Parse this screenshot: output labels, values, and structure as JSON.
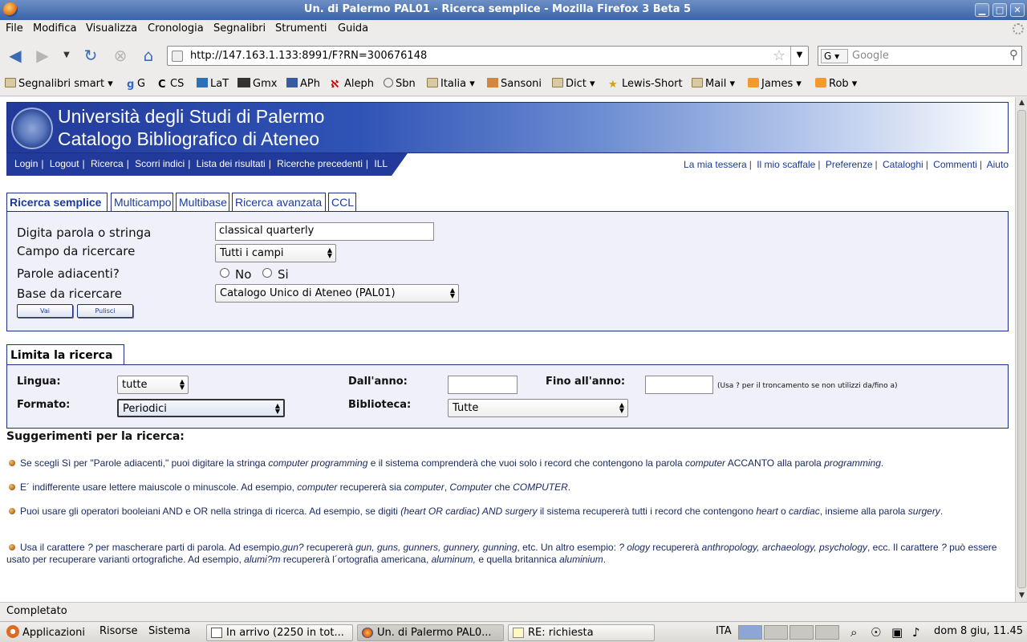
{
  "window": {
    "title": "Un. di Palermo PAL01 - Ricerca semplice - Mozilla Firefox 3 Beta 5"
  },
  "menu": [
    "File",
    "Modifica",
    "Visualizza",
    "Cronologia",
    "Segnalibri",
    "Strumenti",
    "Guida"
  ],
  "nav": {
    "url": "http://147.163.1.133:8991/F?RN=300676148",
    "search_placeholder": "Google",
    "search_engine": "G"
  },
  "bookmarks": [
    "Segnalibri smart",
    "G",
    "CS",
    "LaT",
    "Gmx",
    "APh",
    "Aleph",
    "Sbn",
    "Italia",
    "Sansoni",
    "Dict",
    "Lewis-Short",
    "Mail",
    "James",
    "Rob"
  ],
  "banner": {
    "line1": "Università degli Studi di Palermo",
    "line2": "Catalogo Bibliografico di Ateneo"
  },
  "site_nav": [
    "Login",
    "Logout",
    "Ricerca",
    "Scorri indici",
    "Lista dei risultati",
    "Ricerche precedenti",
    "ILL"
  ],
  "top_links": [
    "La mia tessera",
    "Il mio scaffale",
    "Preferenze",
    "Cataloghi",
    "Commenti",
    "Aiuto"
  ],
  "tabs": [
    "Ricerca semplice",
    "Multicampo",
    "Multibase",
    "Ricerca avanzata",
    "CCL"
  ],
  "form": {
    "query_label": "Digita parola o stringa",
    "query_value": "classical quarterly",
    "field_label": "Campo da ricercare",
    "field_value": "Tutti i campi",
    "adjacent_label": "Parole adiacenti?",
    "adjacent_no": "No",
    "adjacent_si": "Si",
    "base_label": "Base da ricercare",
    "base_value": "Catalogo Unico di Ateneo (PAL01)",
    "go_button": "Vai",
    "clear_button": "Pulisci"
  },
  "limit": {
    "title": "Limita la ricerca a:",
    "lingua_label": "Lingua:",
    "lingua_value": "tutte",
    "formato_label": "Formato:",
    "formato_value": "Periodici",
    "dall_label": "Dall'anno:",
    "fino_label": "Fino all'anno:",
    "note": "(Usa ? per il troncamento se non utilizzi da/fino a)",
    "biblioteca_label": "Biblioteca:",
    "biblioteca_value": "Tutte"
  },
  "tips": {
    "title": "Suggerimenti per la ricerca:",
    "t1": [
      "Se scegli Sì per \"Parole adiacenti,\" puoi digitare la stringa ",
      "computer programming",
      " e il sistema comprenderà che vuoi solo i record che contengono la parola ",
      "computer",
      " ACCANTO alla parola ",
      "programming",
      "."
    ],
    "t2": [
      "E´ indifferente usare lettere maiuscole o minuscole. Ad esempio, ",
      "computer",
      " recupererà sia ",
      "computer",
      ", ",
      "Computer",
      " che ",
      "COMPUTER",
      "."
    ],
    "t3": [
      "Puoi usare gli operatori booleiani AND e OR nella stringa di ricerca. Ad esempio, se digiti ",
      "(heart OR cardiac) AND surgery",
      " il sistema recupererà tutti i record che contengono ",
      "heart",
      " o ",
      "cardiac",
      ", insieme alla parola ",
      "surgery",
      "."
    ],
    "t4": [
      "Usa il carattere ",
      "?",
      " per mascherare parti di parola. Ad esempio,",
      "gun?",
      " recupererà ",
      "gun, guns, gunners, gunnery, gunning",
      ", etc. Un altro esempio: ",
      "? ology",
      " recupererà ",
      "anthropology, archaeology, psychology",
      ", ecc. Il carattere ",
      "?",
      " può essere usato per recuperare varianti ortografiche. Ad esempio, ",
      "alumi?m",
      " recupererà l´ortografia americana, ",
      "aluminum,",
      " e quella britannica ",
      "aluminium",
      "."
    ]
  },
  "status": "Completato",
  "taskbar": {
    "apps": "Applicazioni",
    "places": "Risorse",
    "system": "Sistema",
    "task1": "In arrivo (2250 in tot...",
    "task2": "Un. di Palermo PAL0...",
    "task3": "RE: richiesta",
    "lang": "ITA",
    "clock": "dom  8 giu, 11.45"
  }
}
